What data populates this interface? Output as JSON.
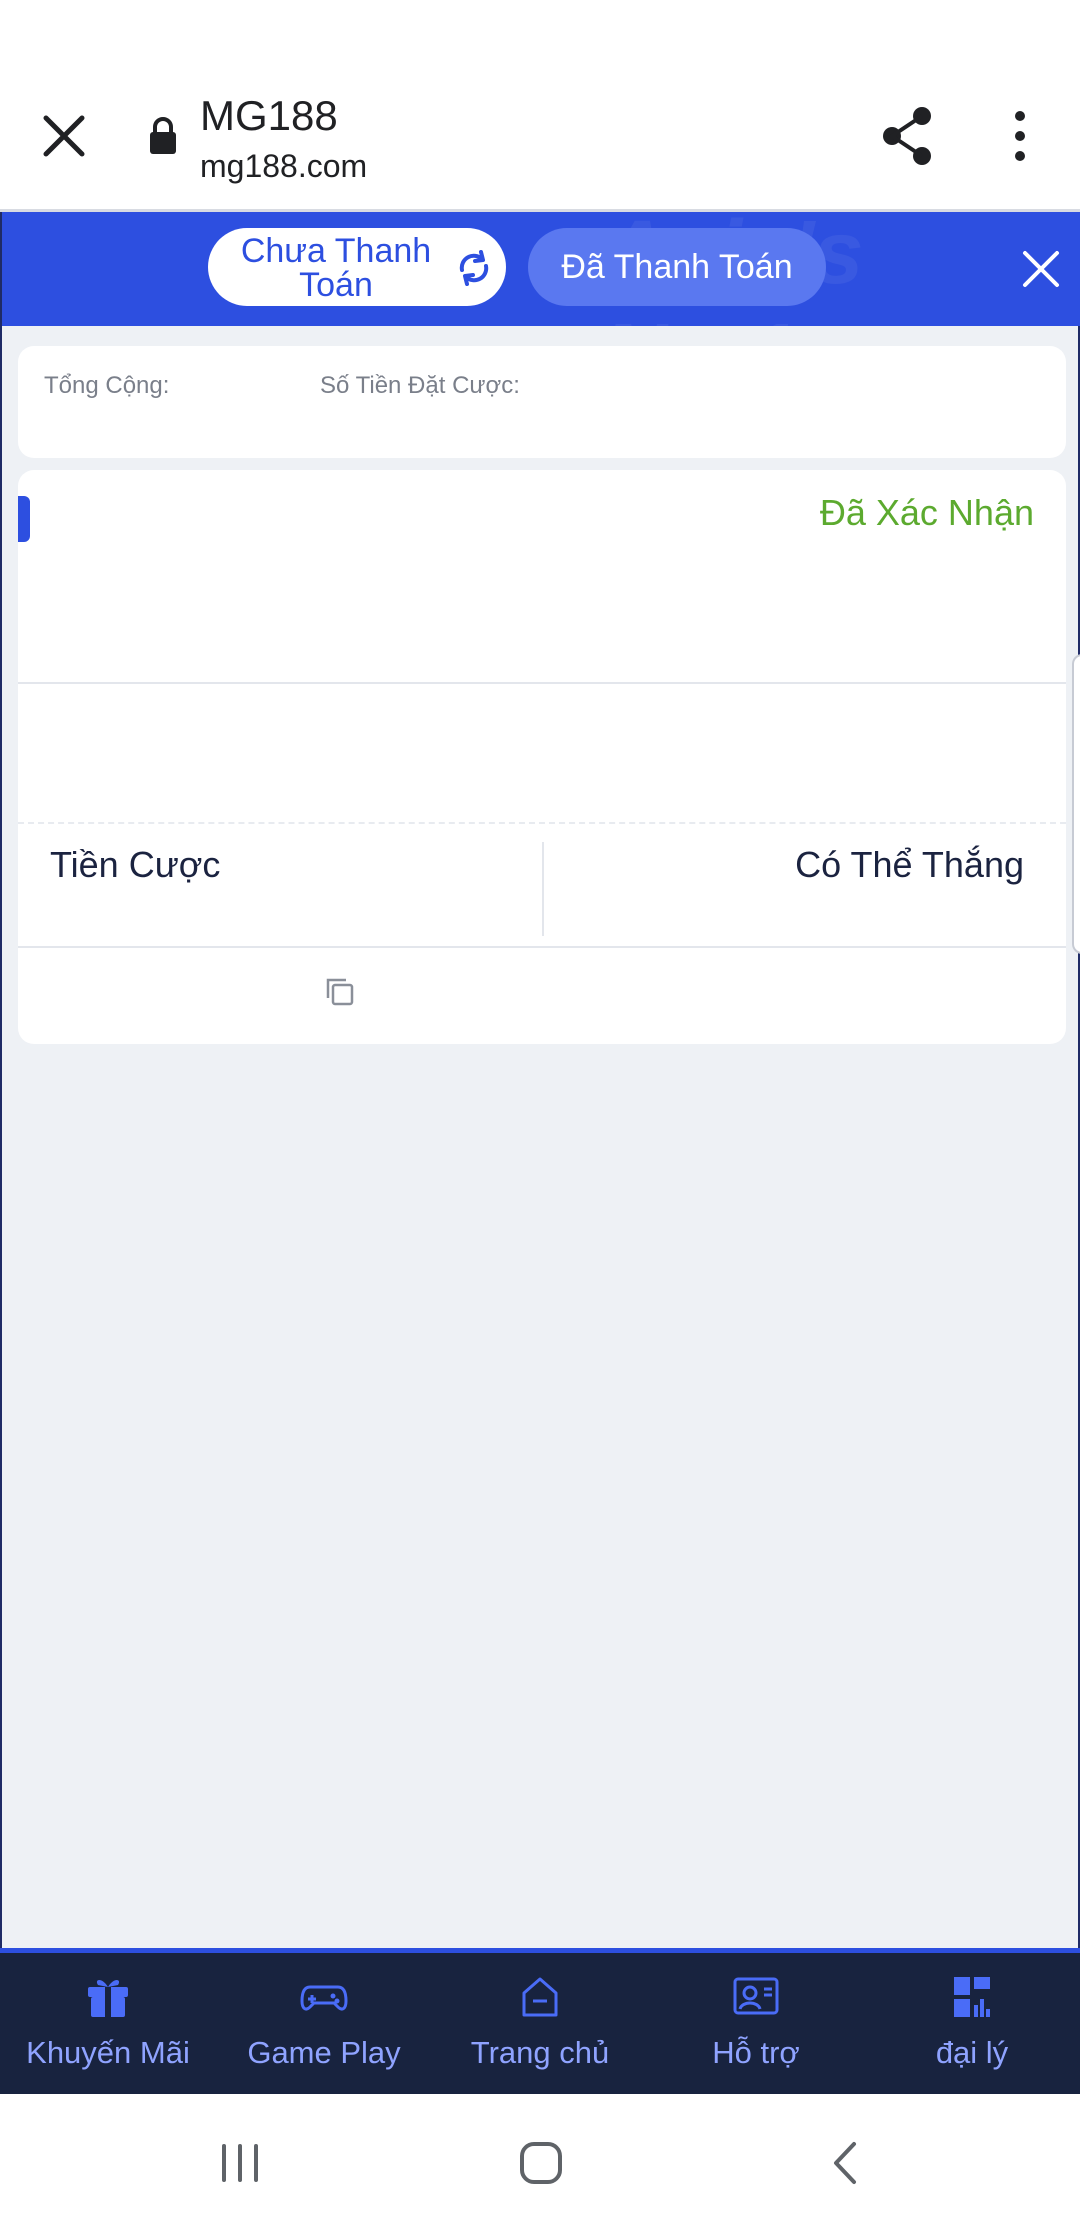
{
  "browser": {
    "title": "MG188",
    "url": "mg188.com",
    "icons": {
      "close": "close-icon",
      "lock": "lock-icon",
      "share": "share-icon",
      "more": "more-vert-icon"
    }
  },
  "header": {
    "tabs": [
      {
        "label": "Chưa Thanh Toán",
        "active": true
      },
      {
        "label": "Đã Thanh Toán",
        "active": false
      }
    ],
    "colors": {
      "brand": "#2d4fe0",
      "success": "#5caa2f",
      "nav_bg": "#18233f"
    }
  },
  "summary": {
    "total_label": "Tổng Cộng:",
    "stake_label": "Số Tiền Đặt Cược:"
  },
  "bet": {
    "status": "Đã Xác Nhận",
    "stake_label": "Tiền Cược",
    "potential_win_label": "Có Thể Thắng"
  },
  "bottom_nav": {
    "items": [
      {
        "label": "Khuyến Mãi",
        "icon": "gift-icon"
      },
      {
        "label": "Game Play",
        "icon": "gamepad-icon"
      },
      {
        "label": "Trang chủ",
        "icon": "home-icon"
      },
      {
        "label": "Hỗ trợ",
        "icon": "support-icon"
      },
      {
        "label": "đại lý",
        "icon": "agent-dashboard-icon"
      }
    ]
  }
}
